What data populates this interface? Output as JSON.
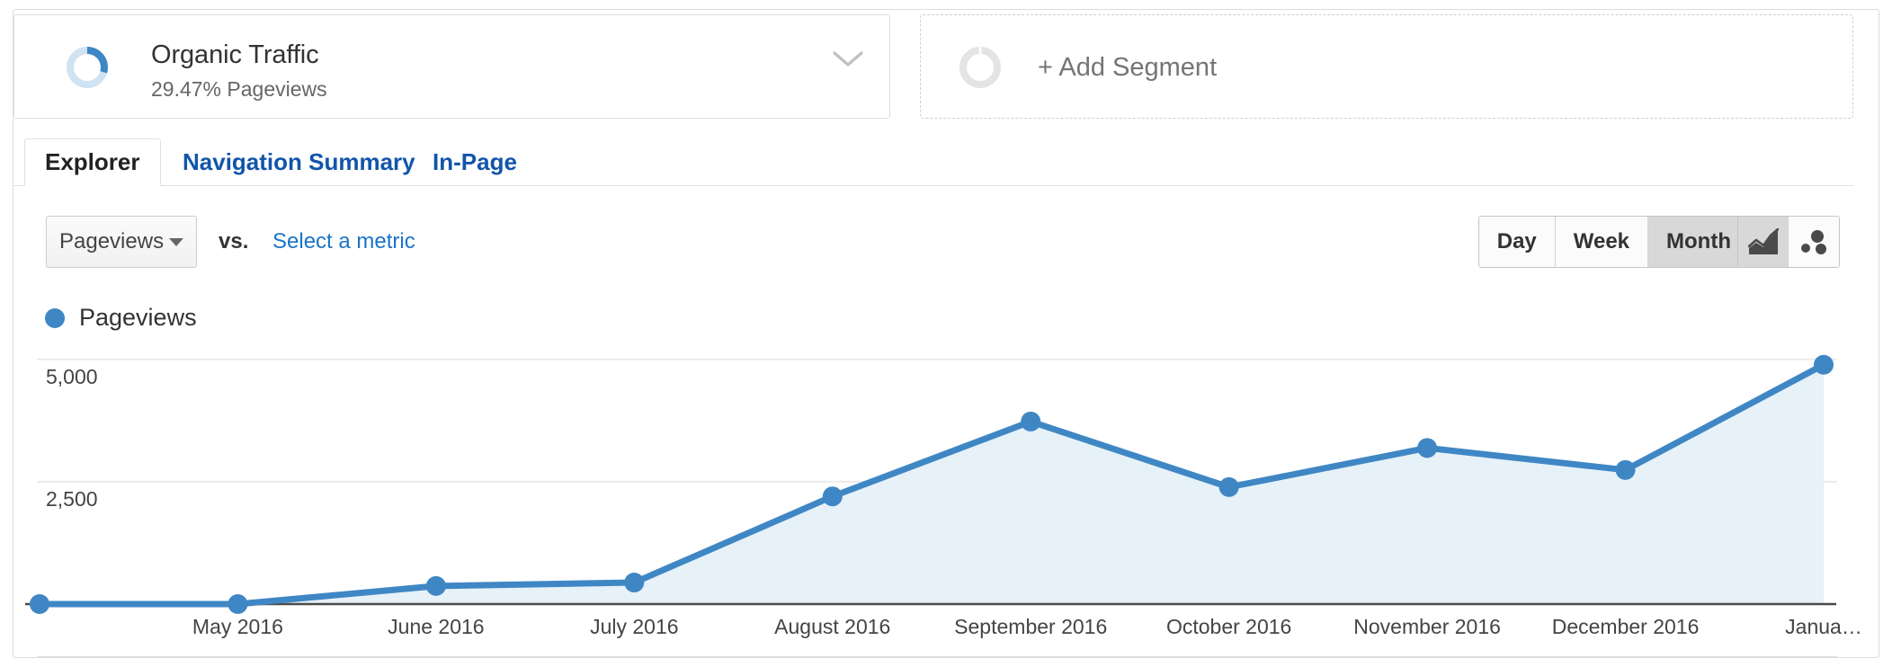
{
  "segment": {
    "name": "Organic Traffic",
    "subtitle": "29.47% Pageviews",
    "percent": 29.47,
    "donut_fill_color": "#3f87c4",
    "donut_track_color": "#cfe3f2",
    "chevron_icon": "chevron-down-icon"
  },
  "add_segment": {
    "label": "+ Add Segment",
    "donut_icon": "donut-outline-icon",
    "donut_color": "#e4e4e4"
  },
  "tabs": [
    {
      "label": "Explorer",
      "active": true
    },
    {
      "label": "Navigation Summary",
      "active": false
    },
    {
      "label": "In-Page",
      "active": false
    }
  ],
  "controls": {
    "metric_selected": "Pageviews",
    "vs_label": "vs.",
    "select_metric_label": "Select a metric",
    "caret_icon": "caret-down-icon",
    "granularity": {
      "options": [
        "Day",
        "Week",
        "Month"
      ],
      "selected": "Month"
    },
    "visualization": {
      "options": [
        "line-chart-icon",
        "motion-chart-icon"
      ],
      "selected": "line-chart-icon"
    }
  },
  "legend": {
    "label": "Pageviews",
    "color": "#3f87c4"
  },
  "chart_data": {
    "type": "line",
    "title": "",
    "xlabel": "",
    "ylabel": "",
    "series": [
      {
        "name": "Pageviews",
        "color": "#3f87c4",
        "fill_color": "#e6f1f8",
        "values": [
          0,
          0,
          370,
          440,
          2200,
          3730,
          2390,
          3190,
          2740,
          4890
        ]
      }
    ],
    "categories": [
      "",
      "May 2016",
      "June 2016",
      "July 2016",
      "August 2016",
      "September 2016",
      "October 2016",
      "November 2016",
      "December 2016",
      "Janua…"
    ],
    "tick_labels": [
      "May 2016",
      "June 2016",
      "July 2016",
      "August 2016",
      "September 2016",
      "October 2016",
      "November 2016",
      "December 2016",
      "Janua…"
    ],
    "ylim": [
      0,
      5400
    ],
    "yticks": [
      2500,
      5000
    ],
    "ytick_labels": [
      "2,500",
      "5,000"
    ],
    "grid": true,
    "legend_position": "top-left"
  }
}
